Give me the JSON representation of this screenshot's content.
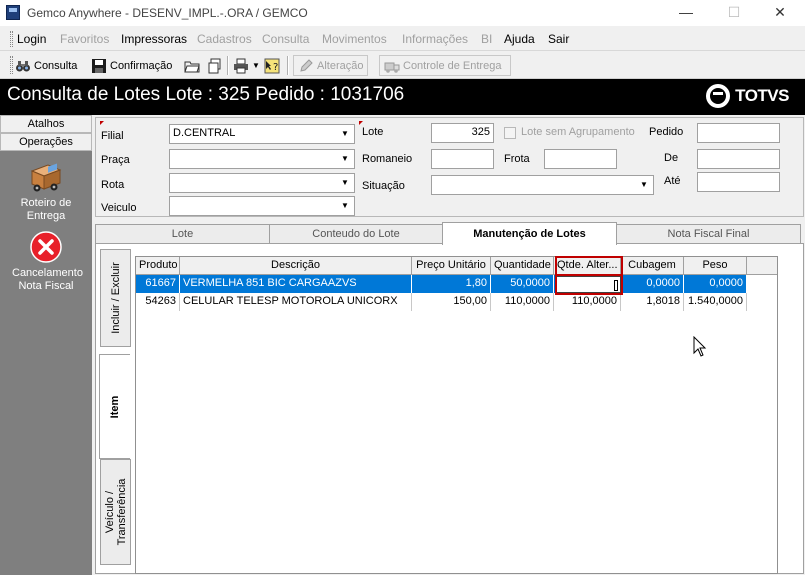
{
  "window": {
    "title": "Gemco Anywhere - DESENV_IMPL.-.ORA / GEMCO",
    "minimize": "—",
    "maximize": "☐",
    "close": "✕"
  },
  "menu": [
    {
      "label": "Login",
      "enabled": true
    },
    {
      "label": "Favoritos",
      "enabled": false
    },
    {
      "label": "Impressoras",
      "enabled": true
    },
    {
      "label": "Cadastros",
      "enabled": false
    },
    {
      "label": "Consulta",
      "enabled": false
    },
    {
      "label": "Movimentos",
      "enabled": false
    },
    {
      "label": "Informações",
      "enabled": false
    },
    {
      "label": "BI",
      "enabled": false
    },
    {
      "label": "Ajuda",
      "enabled": true
    },
    {
      "label": "Sair",
      "enabled": true
    }
  ],
  "toolbar": {
    "consulta": "Consulta",
    "confirmacao": "Confirmação",
    "alteracao": "Alteração",
    "controle_entrega": "Controle de Entrega"
  },
  "header": {
    "title": "Consulta de Lotes  Lote : 325 Pedido : 1031706",
    "logo": "TOTVS"
  },
  "leftnav": {
    "atalhos": "Atalhos",
    "operacoes": "Operações",
    "items": [
      {
        "label": "Roteiro de Entrega",
        "icon": "truck-icon"
      },
      {
        "label": "Cancelamento Nota Fiscal",
        "icon": "cancel-icon"
      }
    ]
  },
  "form": {
    "filial_label": "Filial",
    "filial_value": "D.CENTRAL",
    "praca_label": "Praça",
    "praca_value": "",
    "rota_label": "Rota",
    "rota_value": "",
    "veiculo_label": "Veiculo",
    "veiculo_value": "",
    "lote_label": "Lote",
    "lote_value": "325",
    "lote_sem_agrupamento_label": "Lote sem Agrupamento",
    "romaneio_label": "Romaneio",
    "romaneio_value": "",
    "frota_label": "Frota",
    "frota_value": "",
    "situacao_label": "Situação",
    "situacao_value": "",
    "pedido_label": "Pedido",
    "pedido_value": "",
    "de_label": "De",
    "de_value": "",
    "ate_label": "Até",
    "ate_value": ""
  },
  "tabs": [
    {
      "label": "Lote",
      "active": false
    },
    {
      "label": "Conteudo do Lote",
      "active": false
    },
    {
      "label": "Manutenção de Lotes",
      "active": true
    },
    {
      "label": "Nota Fiscal Final",
      "active": false
    }
  ],
  "side_tabs": [
    {
      "label": "Incluir / Excluir"
    },
    {
      "label": "Item"
    },
    {
      "label": "Veículo / Transferência"
    }
  ],
  "grid": {
    "columns": [
      "Produto",
      "Descrição",
      "Preço Unitário",
      "Quantidade",
      "Qtde. Alter...",
      "Cubagem",
      "Peso"
    ],
    "rows": [
      [
        "61667",
        "VERMELHA 851 BIC CARGAAZVS",
        "1,80",
        "50,0000",
        "",
        "0,0000",
        "0,0000"
      ],
      [
        "54263",
        "CELULAR TELESP MOTOROLA UNICORX",
        "150,00",
        "110,0000",
        "110,0000",
        "1,8018",
        "1.540,0000"
      ]
    ],
    "selected_row": 0
  }
}
